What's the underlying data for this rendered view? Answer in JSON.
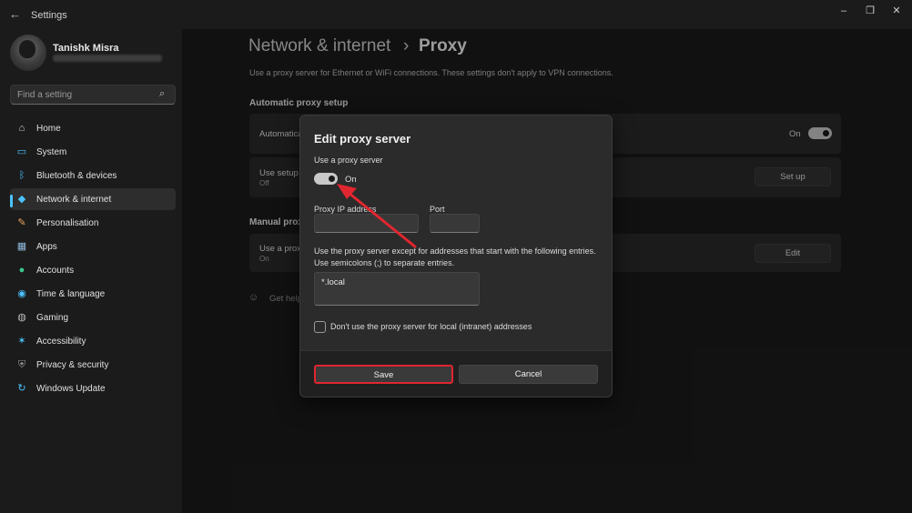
{
  "window": {
    "title": "Settings",
    "back_icon": "back-arrow-icon",
    "controls": [
      "minimize-icon",
      "restore-icon",
      "close-icon"
    ]
  },
  "user": {
    "name": "Tanishk Misra"
  },
  "search": {
    "placeholder": "Find a setting"
  },
  "sidebar": {
    "items": [
      {
        "label": "Home",
        "icon": "home-icon",
        "color": "#d9d9d9"
      },
      {
        "label": "System",
        "icon": "system-icon",
        "color": "#4cc2ff"
      },
      {
        "label": "Bluetooth & devices",
        "icon": "bluetooth-icon",
        "color": "#4cc2ff"
      },
      {
        "label": "Network & internet",
        "icon": "network-icon",
        "color": "#4cc2ff",
        "selected": true
      },
      {
        "label": "Personalisation",
        "icon": "brush-icon",
        "color": "#e8a45b"
      },
      {
        "label": "Apps",
        "icon": "apps-icon",
        "color": "#8fb7d9"
      },
      {
        "label": "Accounts",
        "icon": "accounts-icon",
        "color": "#3bc88f"
      },
      {
        "label": "Time & language",
        "icon": "globe-icon",
        "color": "#4cc2ff"
      },
      {
        "label": "Gaming",
        "icon": "gaming-icon",
        "color": "#bdbdbd"
      },
      {
        "label": "Accessibility",
        "icon": "accessibility-icon",
        "color": "#4cc2ff"
      },
      {
        "label": "Privacy & security",
        "icon": "shield-icon",
        "color": "#9a9a9a"
      },
      {
        "label": "Windows Update",
        "icon": "update-icon",
        "color": "#4cc2ff"
      }
    ]
  },
  "breadcrumb": {
    "parent": "Network & internet",
    "separator": "›",
    "current": "Proxy"
  },
  "description": "Use a proxy server for Ethernet or WiFi connections. These settings don't apply to VPN connections.",
  "automatic": {
    "heading": "Automatic proxy setup",
    "detect_title": "Automatica",
    "detect_state": "On",
    "script_title": "Use setup s",
    "script_state": "Off",
    "setup_button": "Set up"
  },
  "manual": {
    "heading": "Manual proxy",
    "title": "Use a proxy",
    "state": "On",
    "edit_button": "Edit"
  },
  "help": {
    "label": "Get help"
  },
  "dialog": {
    "title": "Edit proxy server",
    "use_proxy_label": "Use a proxy server",
    "toggle_state": "On",
    "ip_label": "Proxy IP address",
    "ip_value": "",
    "port_label": "Port",
    "port_value": "",
    "exceptions_line1": "Use the proxy server except for addresses that start with the following entries.",
    "exceptions_line2": "Use semicolons (;) to separate entries.",
    "exceptions_value": "*.local",
    "local_checkbox_label": "Don't use the proxy server for local (intranet) addresses",
    "save_label": "Save",
    "cancel_label": "Cancel"
  },
  "colors": {
    "accent": "#4cc2ff",
    "highlight": "#e0262f",
    "arrow": "#e0262f"
  }
}
